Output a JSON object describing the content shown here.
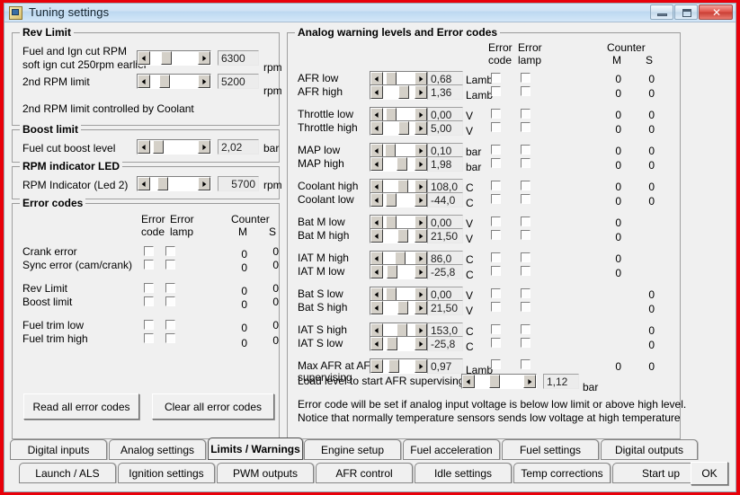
{
  "window": {
    "title": "Tuning settings",
    "icon": "app-icon",
    "buttons": {
      "minimize": "minimize",
      "maximize": "maximize",
      "close": "✕"
    }
  },
  "rev_limit": {
    "legend": "Rev Limit",
    "rows": [
      {
        "label_line1": "Fuel and Ign cut RPM",
        "label_line2": "soft ign cut 250rpm earlier",
        "value": "6300",
        "unit": "rpm",
        "thumb": 22
      },
      {
        "label_line1": "2nd RPM limit",
        "label_line2": "",
        "value": "5200",
        "unit": "rpm",
        "thumb": 18
      }
    ],
    "footnote": "2nd RPM limit controlled by Coolant"
  },
  "boost_limit": {
    "legend": "Boost limit",
    "label": "Fuel cut boost level",
    "value": "2,02",
    "unit": "bar",
    "thumb": 5
  },
  "rpm_led": {
    "legend": "RPM indicator LED",
    "label": "RPM Indicator (Led 2)",
    "value": "5700",
    "unit": "rpm",
    "thumb": 16
  },
  "error_codes": {
    "legend": "Error codes",
    "headers": {
      "error_code_l1": "Error",
      "error_code_l2": "code",
      "error_lamp_l1": "Error",
      "error_lamp_l2": "lamp",
      "counter": "Counter",
      "counter_m": "M",
      "counter_s": "S"
    },
    "rows": [
      {
        "label": "Crank error",
        "code": false,
        "lamp": false,
        "m": "0",
        "s": "0"
      },
      {
        "label": "Sync error (cam/crank)",
        "code": false,
        "lamp": false,
        "m": "0",
        "s": "0"
      },
      {
        "label": "Rev Limit",
        "code": false,
        "lamp": false,
        "m": "0",
        "s": "0"
      },
      {
        "label": "Boost limit",
        "code": false,
        "lamp": false,
        "m": "0",
        "s": "0"
      },
      {
        "label": "Fuel trim low",
        "code": false,
        "lamp": false,
        "m": "0",
        "s": "0"
      },
      {
        "label": "Fuel trim high",
        "code": false,
        "lamp": false,
        "m": "0",
        "s": "0"
      }
    ],
    "read_button": "Read all error codes",
    "clear_button": "Clear all error codes"
  },
  "analog": {
    "legend": "Analog warning levels and Error codes",
    "headers": {
      "error_code_l1": "Error",
      "error_code_l2": "code",
      "error_lamp_l1": "Error",
      "error_lamp_l2": "lamp",
      "counter": "Counter",
      "counter_m": "M",
      "counter_s": "S"
    },
    "rows": [
      {
        "label": "AFR low",
        "value": "0,68",
        "unit": "Lamb",
        "thumb": 8,
        "code": false,
        "lamp": false,
        "m": "0",
        "s": "0"
      },
      {
        "label": "AFR high",
        "value": "1,36",
        "unit": "Lamb",
        "thumb": 48,
        "code": false,
        "lamp": false,
        "m": "0",
        "s": "0"
      },
      {
        "label": "Throttle low",
        "value": "0,00",
        "unit": "V",
        "thumb": 8,
        "code": false,
        "lamp": false,
        "m": "0",
        "s": "0"
      },
      {
        "label": "Throttle high",
        "value": "5,00",
        "unit": "V",
        "thumb": 48,
        "code": false,
        "lamp": false,
        "m": "0",
        "s": "0"
      },
      {
        "label": "MAP low",
        "value": "0,10",
        "unit": "bar",
        "thumb": 6,
        "code": false,
        "lamp": false,
        "m": "0",
        "s": "0"
      },
      {
        "label": "MAP high",
        "value": "1,98",
        "unit": "bar",
        "thumb": 44,
        "code": false,
        "lamp": false,
        "m": "0",
        "s": "0"
      },
      {
        "label": "Coolant high",
        "value": "108,0",
        "unit": "C",
        "thumb": 46,
        "code": false,
        "lamp": false,
        "m": "0",
        "s": "0"
      },
      {
        "label": "Coolant low",
        "value": "-44,0",
        "unit": "C",
        "thumb": 8,
        "code": false,
        "lamp": false,
        "m": "0",
        "s": "0"
      },
      {
        "label": "Bat M low",
        "value": "0,00",
        "unit": "V",
        "thumb": 8,
        "code": false,
        "lamp": false,
        "m": "0",
        "s": ""
      },
      {
        "label": "Bat M high",
        "value": "21,50",
        "unit": "V",
        "thumb": 46,
        "code": false,
        "lamp": false,
        "m": "0",
        "s": ""
      },
      {
        "label": "IAT M high",
        "value": "86,0",
        "unit": "C",
        "thumb": 38,
        "code": false,
        "lamp": false,
        "m": "0",
        "s": ""
      },
      {
        "label": "IAT M low",
        "value": "-25,8",
        "unit": "C",
        "thumb": 10,
        "code": false,
        "lamp": false,
        "m": "0",
        "s": ""
      },
      {
        "label": "Bat S low",
        "value": "0,00",
        "unit": "V",
        "thumb": 8,
        "code": false,
        "lamp": false,
        "m": "",
        "s": "0"
      },
      {
        "label": "Bat S high",
        "value": "21,50",
        "unit": "V",
        "thumb": 46,
        "code": false,
        "lamp": false,
        "m": "",
        "s": "0"
      },
      {
        "label": "IAT S high",
        "value": "153,0",
        "unit": "C",
        "thumb": 44,
        "code": false,
        "lamp": false,
        "m": "",
        "s": "0"
      },
      {
        "label": "IAT S low",
        "value": "-25,8",
        "unit": "C",
        "thumb": 10,
        "code": false,
        "lamp": false,
        "m": "",
        "s": "0"
      }
    ],
    "max_afr": {
      "label_line1": "Max AFR at AFR",
      "label_line2": "supervising",
      "value": "0,97",
      "unit": "Lamb",
      "thumb": 18,
      "code": false,
      "lamp": false,
      "m": "0",
      "s": "0"
    },
    "load_level": {
      "label": "Load level to start AFR supervising",
      "value": "1,12",
      "unit": "bar",
      "thumb": 30
    },
    "note_line1": "Error code will be set if analog input voltage is below low limit or above high level.",
    "note_line2": "Notice that normally temperature sensors sends low voltage at high temperature"
  },
  "tabs": {
    "row1": [
      {
        "label": "Digital inputs",
        "selected": false
      },
      {
        "label": "Analog settings",
        "selected": false
      },
      {
        "label": "Limits / Warnings",
        "selected": true
      },
      {
        "label": "Engine setup",
        "selected": false
      },
      {
        "label": "Fuel acceleration",
        "selected": false
      },
      {
        "label": "Fuel settings",
        "selected": false
      },
      {
        "label": "Digital outputs",
        "selected": false
      }
    ],
    "row2": [
      {
        "label": "Launch / ALS",
        "selected": false
      },
      {
        "label": "Ignition settings",
        "selected": false
      },
      {
        "label": "PWM outputs",
        "selected": false
      },
      {
        "label": "AFR control",
        "selected": false
      },
      {
        "label": "Idle settings",
        "selected": false
      },
      {
        "label": "Temp corrections",
        "selected": false
      },
      {
        "label": "Start up",
        "selected": false
      }
    ]
  },
  "ok_button": "OK"
}
